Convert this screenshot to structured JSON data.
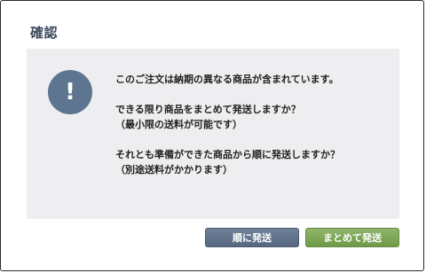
{
  "dialog": {
    "title": "確認"
  },
  "message": {
    "icon": "exclamation-icon",
    "icon_glyph": "!",
    "line1": "このご注文は納期の異なる商品が含まれています。",
    "line2": "できる限り商品をまとめて発送しますか？",
    "line3": "（最小限の送料が可能です）",
    "line4": "それとも準備ができた商品から順に発送しますか？",
    "line5": "（別途送料がかかります）"
  },
  "buttons": {
    "ship_in_order_label": "順に発送",
    "ship_together_label": "まとめて発送"
  },
  "colors": {
    "title": "#3a4a5c",
    "panel_bg": "#eeeef0",
    "icon_bg": "#5d7591",
    "btn_order": "#5f7089",
    "btn_together": "#7aa552"
  }
}
